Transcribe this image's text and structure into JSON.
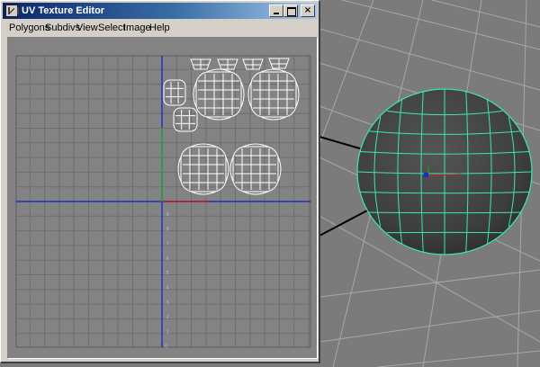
{
  "window": {
    "title": "UV Texture Editor",
    "buttons": {
      "minimize": "",
      "maximize": "",
      "close": "×"
    }
  },
  "menu": [
    "Polygons",
    "Subdivs",
    "View",
    "Select",
    "Image",
    "Help"
  ],
  "uv_editor": {
    "tick_labels": [
      ".9",
      ".8",
      ".7",
      ".6",
      ".5",
      ".4",
      ".3",
      ".2",
      ".1",
      "0"
    ],
    "colors": {
      "background": "#838383",
      "grid": "#6e6e6e",
      "uv_lines": "#ffffff",
      "u_axis": "#1a2cc8",
      "v_axis": "#1a2cc8",
      "u_axis_positive": "#c02020",
      "v_axis_positive": "#20b020"
    }
  },
  "viewport": {
    "colors": {
      "background": "#7b7b7b",
      "grid": "#a8a8a8",
      "axis_lines": "#000000",
      "sphere": "#4a4a4a",
      "wireframe": "#3de6b0"
    }
  }
}
